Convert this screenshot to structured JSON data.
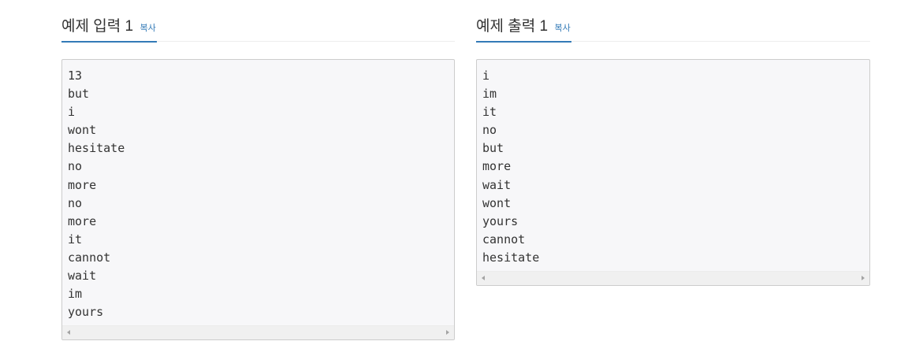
{
  "input": {
    "title": "예제 입력 1",
    "copy_label": "복사",
    "text": "13\nbut\ni\nwont\nhesitate\nno\nmore\nno\nmore\nit\ncannot\nwait\nim\nyours"
  },
  "output": {
    "title": "예제 출력 1",
    "copy_label": "복사",
    "text": "i\nim\nit\nno\nbut\nmore\nwait\nwont\nyours\ncannot\nhesitate"
  },
  "colors": {
    "accent": "#337ab7",
    "box_background": "#f7f7f9",
    "box_border": "#cccccc"
  }
}
